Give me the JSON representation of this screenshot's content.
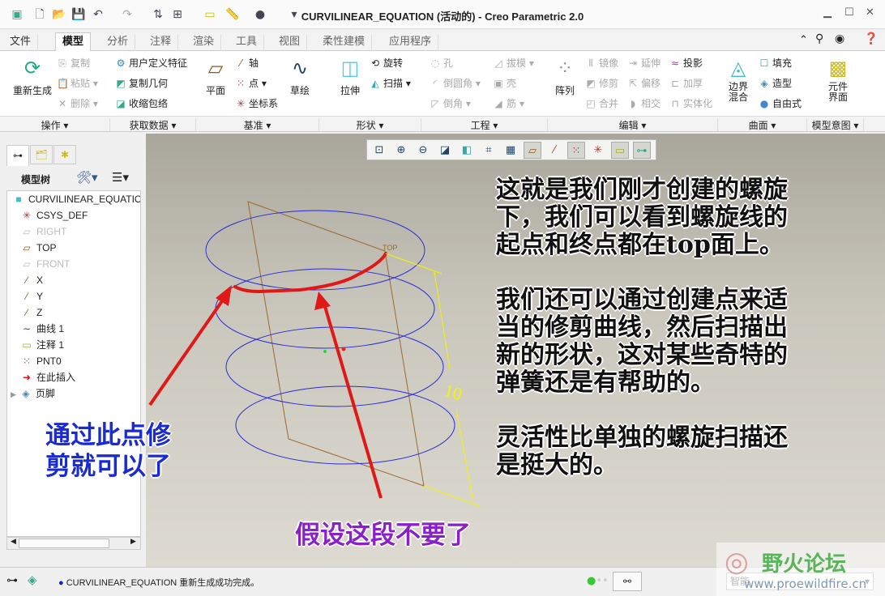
{
  "window": {
    "title": "CURVILINEAR_EQUATION (活动的) - Creo Parametric 2.0"
  },
  "tabs": [
    "文件",
    "模型",
    "分析",
    "注释",
    "渲染",
    "工具",
    "视图",
    "柔性建模",
    "应用程序"
  ],
  "ribbon": {
    "operations": {
      "regen": "重新生成",
      "copy": "复制",
      "paste": "粘贴",
      "delete": "删除",
      "label": "操作"
    },
    "getdata": {
      "udf": "用户定义特征",
      "copygeom": "复制几何",
      "shrinkwrap": "收缩包络",
      "label": "获取数据"
    },
    "datum": {
      "plane": "平面",
      "axis": "轴",
      "point": "点",
      "csys": "坐标系",
      "sketch": "草绘",
      "label": "基准"
    },
    "shapes": {
      "extrude": "拉伸",
      "revolve": "旋转",
      "sweep": "扫描",
      "label": "形状"
    },
    "engineering": {
      "hole": "孔",
      "round": "倒圆角",
      "chamfer": "倒角",
      "draft": "拔模",
      "shell": "壳",
      "rib": "筋",
      "label": "工程"
    },
    "editing": {
      "pattern": "阵列",
      "mirror": "镜像",
      "trim": "修剪",
      "merge": "合并",
      "extend": "延伸",
      "offset": "偏移",
      "intersect": "相交",
      "project": "投影",
      "thicken": "加厚",
      "solidify": "实体化",
      "label": "编辑"
    },
    "surfaces": {
      "boundary1": "边界",
      "boundary2": "混合",
      "fill": "填充",
      "style": "造型",
      "freestyle": "自由式",
      "label": "曲面"
    },
    "intent": {
      "comp1": "元件",
      "comp2": "界面",
      "label": "模型意图"
    }
  },
  "model_tree": {
    "header": "模型树",
    "items": [
      {
        "label": "CURVILINEAR_EQUATION",
        "icon": "part-icon"
      },
      {
        "label": "CSYS_DEF",
        "icon": "csys-icon"
      },
      {
        "label": "RIGHT",
        "icon": "plane-icon",
        "dim": true
      },
      {
        "label": "TOP",
        "icon": "plane-icon"
      },
      {
        "label": "FRONT",
        "icon": "plane-icon",
        "dim": true
      },
      {
        "label": "X",
        "icon": "axis-icon"
      },
      {
        "label": "Y",
        "icon": "axis-icon"
      },
      {
        "label": "Z",
        "icon": "axis-icon"
      },
      {
        "label": "曲线 1",
        "icon": "curve-icon"
      },
      {
        "label": "注释 1",
        "icon": "note-icon"
      },
      {
        "label": "PNT0",
        "icon": "point-icon"
      },
      {
        "label": "在此插入",
        "icon": "insert-arrow-icon"
      },
      {
        "label": "页脚",
        "icon": "footer-icon"
      }
    ]
  },
  "graphics": {
    "plane_label": "TOP",
    "dimension": "10"
  },
  "annotations": {
    "right": [
      "这就是我们刚才创建的螺旋",
      "下，我们可以看到螺旋线的",
      "起点和终点都在top面上。",
      "",
      "我们还可以通过创建点来适",
      "当的修剪曲线，然后扫描出",
      "新的形状，这对某些奇特的",
      "弹簧还是有帮助的。",
      "",
      "灵活性比单独的螺旋扫描还",
      "是挺大的。"
    ],
    "blue": [
      "通过此点修",
      "剪就可以了"
    ],
    "purple": "假设这段不要了"
  },
  "status": {
    "message": "CURVILINEAR_EQUATION 重新生成成功完成。",
    "filter": "智能"
  },
  "watermark": {
    "name": "野火论坛",
    "url": "www.proewildfire.cn"
  },
  "colors": {
    "helix": "#2a2ad8",
    "plane": "#9a6a30",
    "red": "#e01818",
    "blue_text": "#1a2bd0",
    "purple_text": "#8a20c8",
    "dim": "#f4f400"
  }
}
